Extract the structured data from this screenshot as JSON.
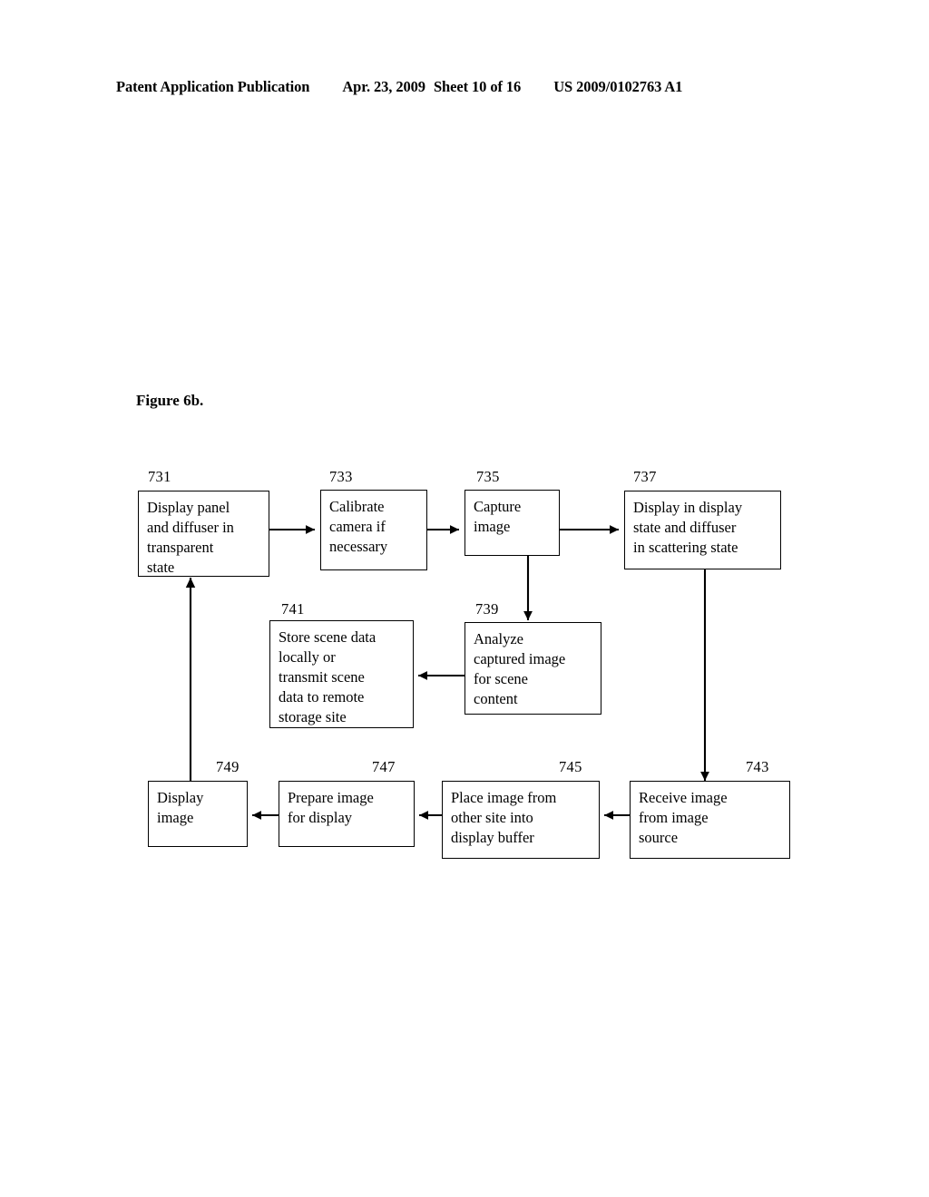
{
  "header": {
    "publication": "Patent Application Publication",
    "date": "Apr. 23, 2009",
    "sheet": "Sheet 10 of 16",
    "number": "US 2009/0102763 A1"
  },
  "figure": {
    "caption": "Figure 6b."
  },
  "diagram": {
    "type": "flowchart",
    "nodes": [
      {
        "ref": "731",
        "text": "Display panel\nand diffuser in\ntransparent\nstate"
      },
      {
        "ref": "733",
        "text": "Calibrate\ncamera if\nnecessary"
      },
      {
        "ref": "735",
        "text": "Capture\nimage"
      },
      {
        "ref": "737",
        "text": "Display in display\nstate and diffuser\nin scattering state"
      },
      {
        "ref": "741",
        "text": "Store scene data\nlocally or\ntransmit scene\ndata to remote\nstorage site"
      },
      {
        "ref": "739",
        "text": "Analyze\ncaptured image\nfor scene\ncontent"
      },
      {
        "ref": "749",
        "text": "Display\nimage"
      },
      {
        "ref": "747",
        "text": "Prepare image\nfor display"
      },
      {
        "ref": "745",
        "text": "Place image from\nother site into\ndisplay buffer"
      },
      {
        "ref": "743",
        "text": "Receive image\nfrom image\nsource"
      }
    ],
    "edges": [
      {
        "from": "731",
        "to": "733",
        "direction": "right"
      },
      {
        "from": "733",
        "to": "735",
        "direction": "right"
      },
      {
        "from": "735",
        "to": "737",
        "direction": "right"
      },
      {
        "from": "735",
        "to": "739",
        "direction": "down"
      },
      {
        "from": "739",
        "to": "741",
        "direction": "left"
      },
      {
        "from": "737",
        "to": "743",
        "direction": "down"
      },
      {
        "from": "743",
        "to": "745",
        "direction": "left"
      },
      {
        "from": "745",
        "to": "747",
        "direction": "left"
      },
      {
        "from": "747",
        "to": "749",
        "direction": "left"
      },
      {
        "from": "749",
        "to": "731",
        "direction": "up"
      }
    ]
  }
}
